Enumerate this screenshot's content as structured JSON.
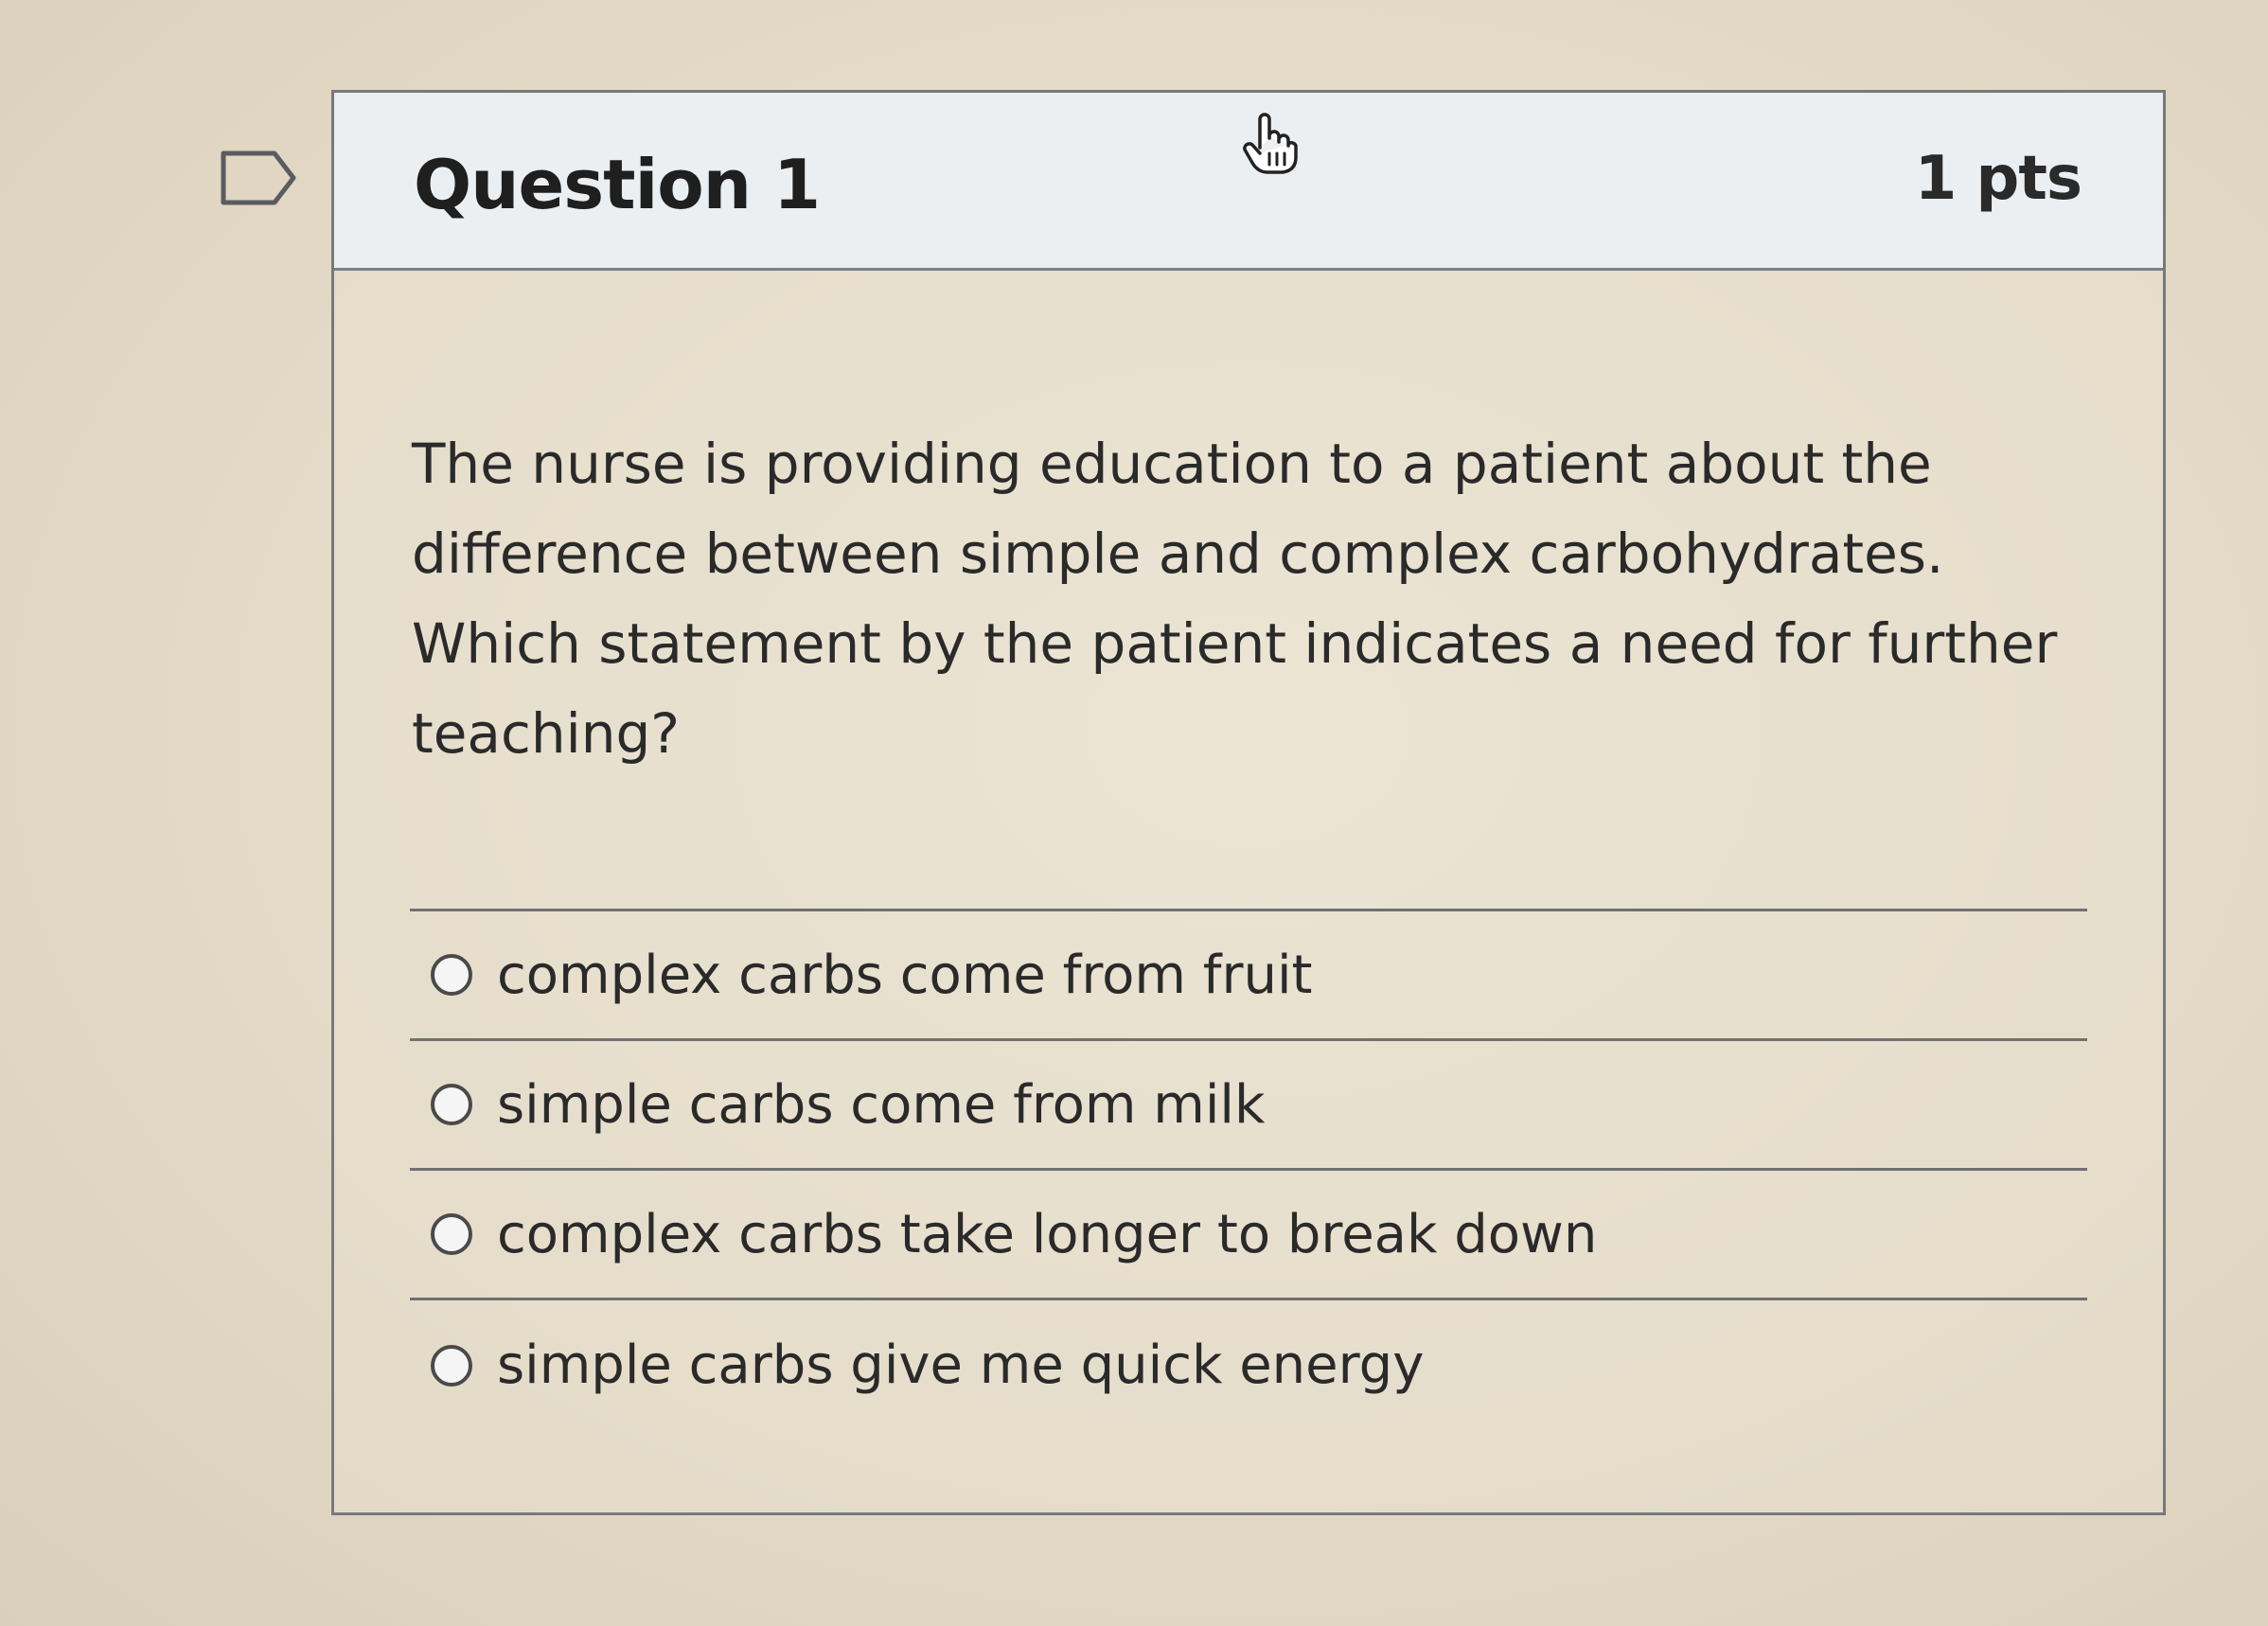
{
  "question": {
    "title": "Question 1",
    "points": "1 pts",
    "text": "The nurse is providing education to a patient about the difference between simple and complex carbohydrates. Which statement by the patient indicates a need for further teaching?",
    "answers": [
      {
        "label": "complex carbs come from fruit",
        "selected": false
      },
      {
        "label": "simple carbs come from milk",
        "selected": false
      },
      {
        "label": "complex carbs take longer to break down",
        "selected": false
      },
      {
        "label": "simple carbs give me quick energy",
        "selected": false
      }
    ]
  },
  "icons": {
    "flag": "flag-outline-icon",
    "cursor": "hand-pointer-icon"
  },
  "colors": {
    "header_bg": "#eceff1",
    "border": "#77797c",
    "text": "#2a2a2a"
  }
}
